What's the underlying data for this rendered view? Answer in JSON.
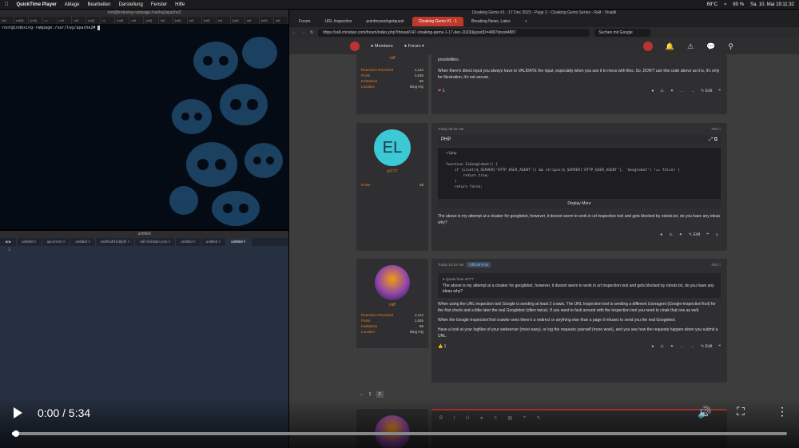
{
  "menubar": {
    "app": "QuickTime Player",
    "items": [
      "Ablage",
      "Bearbeiten",
      "Darstellung",
      "Fenster",
      "Hilfe"
    ],
    "temp": "69°C",
    "battery": "80 %",
    "datetime": "Sa. 10. Mai 19:11:32"
  },
  "terminal": {
    "title": "root@indexing-rampage:/var/log/apache2",
    "tabs": [
      "ralf",
      "ralf@",
      "[ralf]",
      "rc",
      "ralf",
      "ralf",
      "[ralf]",
      "rc",
      "[ralf]",
      "ralf",
      "[ralf]",
      "ralf",
      "[ralf]",
      "ralf",
      "[ralf]",
      "ralf",
      "[ralf]",
      "ralf",
      "[ralf]",
      "ralf"
    ],
    "prompt": "root@indexing-rampage:/var/log/apache2# "
  },
  "editor": {
    "title": "untitled",
    "tabs": [
      "untitled",
      "api.errors",
      "untitled",
      "ssdfssdf1hdhjdh",
      "ralf-christian.com",
      "untitled",
      "untitled",
      "untitled"
    ],
    "line_number": "1"
  },
  "browser": {
    "title": "Cloaking Gems #1 - 17 Dec 2023 - Page 2 - Cloaking Gems Series - Ralf - Vivaldi",
    "tabs": [
      "Forum",
      "URL Inspection",
      "pointmyworkgetquest",
      "Cloaking Gems #1 - 1",
      "Breaking News, Lates"
    ],
    "url": "https://ralf-christian.com/forum/index.php?thread/147-cloaking-gems-1-17-dec-2023/&postID=4887#post4887",
    "search_placeholder": "Suchen mit Google"
  },
  "site": {
    "nav_members": "Members",
    "nav_forum": "Forum"
  },
  "posts": [
    {
      "user": "ralf",
      "stats": [
        [
          "Reactions Received",
          "2,112"
        ],
        [
          "Posts",
          "1,635"
        ],
        [
          "Invitations",
          "86"
        ],
        [
          "Location",
          "Bing HQ"
        ]
      ],
      "text1": "possibilities.",
      "text2": "When there's direct input you always have to VALIDATE the input, especially when you use it to mess with files. So, DON'T use this code above as it is, it's only for illustration, it's not secure.",
      "reactions": "1",
      "edit_label": "Edit"
    },
    {
      "user": "el777",
      "avatar_initials": "EL",
      "stats": [
        [
          "Posts",
          "25"
        ]
      ],
      "date": "Today 09:32 AM",
      "number": "#32",
      "code_title": "PHP",
      "code_lines": [
        "<?php",
        "",
        "function IsGooglebot() {",
        "    if (isset($_SERVER['HTTP_USER_AGENT']) && stripos($_SERVER['HTTP_USER_AGENT'], 'Googlebot') !== false) {",
        "        return true;",
        "    }",
        "    return false;"
      ],
      "display_more": "Display More",
      "text": "The above is my attempt at a cloaker for googlebot, however, it doesnt seem to work in url inspection tool and gets blocked by robots.txt, do you have any ideas why?",
      "edit_label": "Edit"
    },
    {
      "user": "ralf",
      "stats": [
        [
          "Reactions Received",
          "2,112"
        ],
        [
          "Posts",
          "1,635"
        ],
        [
          "Invitations",
          "86"
        ],
        [
          "Location",
          "Bing HQ"
        ]
      ],
      "date": "Today 10:23 AM",
      "badge": "Official Post",
      "number": "#33",
      "quote_from": "Quote from el777",
      "quote_text": "The above is my attempt at a cloaker for googlebot, however, it doesnt seem to work in url inspection tool and gets blocked by robots.txt, do you have any ideas why?",
      "text1": "When using the URL inspection tool Google is sending at least 2 crawls. The URL Inspection tool is sending a different Useragent (Google-InspectionTool) for the first check and a little later the real Googlebot (often twice). If you want to fuck around with the inspection tool you need to cloak that one as well.",
      "text2": "When the Google-InspectionTool crawler sees there's a redirect or anything else than a page it refuses to send you the real Googlebot.",
      "text3": "Have a look at your logfiles of your webserver (most easy), or log the requests yourself (more work), and you see how the requests happen when you submit a URL.",
      "reactions": "1",
      "edit_label": "Edit"
    }
  ],
  "pagination": [
    "1",
    "2"
  ],
  "video": {
    "current": "0:00",
    "total": "5:34",
    "separator": "/",
    "progress": 0.003
  }
}
